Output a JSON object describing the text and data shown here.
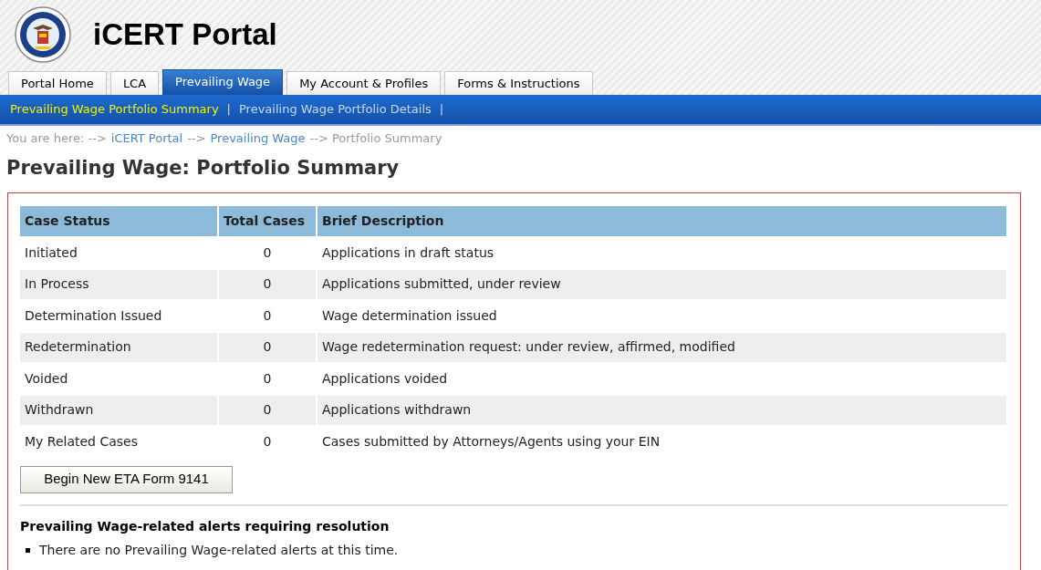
{
  "header": {
    "title": "iCERT Portal"
  },
  "tabs": [
    {
      "label": "Portal Home",
      "selected": false
    },
    {
      "label": "LCA",
      "selected": false
    },
    {
      "label": "Prevailing Wage",
      "selected": true
    },
    {
      "label": "My Account & Profiles",
      "selected": false
    },
    {
      "label": "Forms & Instructions",
      "selected": false
    }
  ],
  "subnav": [
    {
      "label": "Prevailing Wage Portfolio Summary",
      "selected": true
    },
    {
      "label": "Prevailing Wage Portfolio Details",
      "selected": false
    }
  ],
  "separator": "|",
  "breadcrumb": [
    {
      "kind": "text",
      "text": "You are here: -->"
    },
    {
      "kind": "link",
      "text": "iCERT Portal"
    },
    {
      "kind": "text",
      "text": "-->"
    },
    {
      "kind": "link",
      "text": "Prevailing Wage"
    },
    {
      "kind": "text",
      "text": "--> Portfolio Summary"
    }
  ],
  "page_title": "Prevailing Wage: Portfolio Summary",
  "table": {
    "columns": [
      "Case Status",
      "Total Cases",
      "Brief Description"
    ],
    "rows": [
      [
        "Initiated",
        "0",
        "Applications in draft status"
      ],
      [
        "In Process",
        "0",
        "Applications submitted, under review"
      ],
      [
        "Determination Issued",
        "0",
        "Wage determination issued"
      ],
      [
        "Redetermination",
        "0",
        "Wage redetermination request: under review, affirmed, modified"
      ],
      [
        "Voided",
        "0",
        "Applications voided"
      ],
      [
        "Withdrawn",
        "0",
        "Applications withdrawn"
      ],
      [
        "My Related Cases",
        "0",
        "Cases submitted by Attorneys/Agents using your EIN"
      ]
    ]
  },
  "button": "Begin New ETA Form 9141",
  "alerts": {
    "heading": "Prevailing Wage-related alerts requiring resolution",
    "items": [
      "There are no Prevailing Wage-related alerts at this time."
    ]
  }
}
